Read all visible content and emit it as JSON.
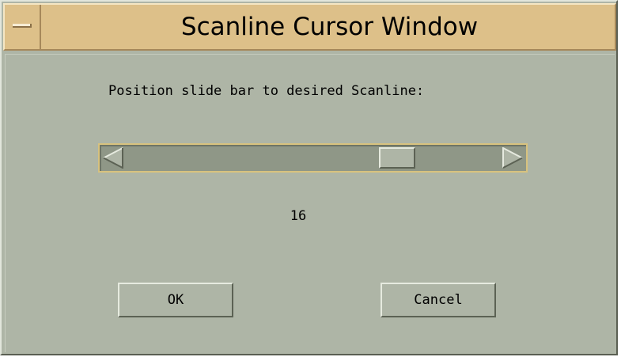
{
  "window": {
    "title": "Scanline Cursor Window"
  },
  "dialog": {
    "prompt": "Position slide bar to desired Scanline:",
    "scanline_value": "16",
    "slider_fraction": 0.75
  },
  "buttons": {
    "ok_label": "OK",
    "cancel_label": "Cancel"
  },
  "colors": {
    "title_bar": "#ddc089",
    "window_bg": "#aeb5a6",
    "scroll_trough": "#8f9787",
    "focus_border": "#d8c27e"
  },
  "icons": {
    "window_menu": "window-menu-icon",
    "scroll_left": "left-arrow-icon",
    "scroll_right": "right-arrow-icon"
  }
}
